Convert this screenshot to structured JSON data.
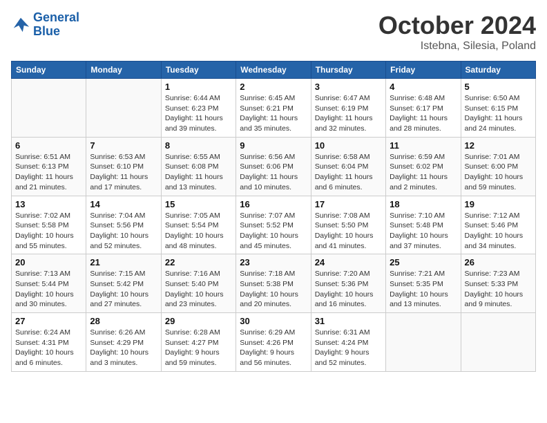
{
  "logo": {
    "line1": "General",
    "line2": "Blue"
  },
  "title": "October 2024",
  "location": "Istebna, Silesia, Poland",
  "headers": [
    "Sunday",
    "Monday",
    "Tuesday",
    "Wednesday",
    "Thursday",
    "Friday",
    "Saturday"
  ],
  "weeks": [
    [
      {
        "day": "",
        "info": ""
      },
      {
        "day": "",
        "info": ""
      },
      {
        "day": "1",
        "info": "Sunrise: 6:44 AM\nSunset: 6:23 PM\nDaylight: 11 hours and 39 minutes."
      },
      {
        "day": "2",
        "info": "Sunrise: 6:45 AM\nSunset: 6:21 PM\nDaylight: 11 hours and 35 minutes."
      },
      {
        "day": "3",
        "info": "Sunrise: 6:47 AM\nSunset: 6:19 PM\nDaylight: 11 hours and 32 minutes."
      },
      {
        "day": "4",
        "info": "Sunrise: 6:48 AM\nSunset: 6:17 PM\nDaylight: 11 hours and 28 minutes."
      },
      {
        "day": "5",
        "info": "Sunrise: 6:50 AM\nSunset: 6:15 PM\nDaylight: 11 hours and 24 minutes."
      }
    ],
    [
      {
        "day": "6",
        "info": "Sunrise: 6:51 AM\nSunset: 6:13 PM\nDaylight: 11 hours and 21 minutes."
      },
      {
        "day": "7",
        "info": "Sunrise: 6:53 AM\nSunset: 6:10 PM\nDaylight: 11 hours and 17 minutes."
      },
      {
        "day": "8",
        "info": "Sunrise: 6:55 AM\nSunset: 6:08 PM\nDaylight: 11 hours and 13 minutes."
      },
      {
        "day": "9",
        "info": "Sunrise: 6:56 AM\nSunset: 6:06 PM\nDaylight: 11 hours and 10 minutes."
      },
      {
        "day": "10",
        "info": "Sunrise: 6:58 AM\nSunset: 6:04 PM\nDaylight: 11 hours and 6 minutes."
      },
      {
        "day": "11",
        "info": "Sunrise: 6:59 AM\nSunset: 6:02 PM\nDaylight: 11 hours and 2 minutes."
      },
      {
        "day": "12",
        "info": "Sunrise: 7:01 AM\nSunset: 6:00 PM\nDaylight: 10 hours and 59 minutes."
      }
    ],
    [
      {
        "day": "13",
        "info": "Sunrise: 7:02 AM\nSunset: 5:58 PM\nDaylight: 10 hours and 55 minutes."
      },
      {
        "day": "14",
        "info": "Sunrise: 7:04 AM\nSunset: 5:56 PM\nDaylight: 10 hours and 52 minutes."
      },
      {
        "day": "15",
        "info": "Sunrise: 7:05 AM\nSunset: 5:54 PM\nDaylight: 10 hours and 48 minutes."
      },
      {
        "day": "16",
        "info": "Sunrise: 7:07 AM\nSunset: 5:52 PM\nDaylight: 10 hours and 45 minutes."
      },
      {
        "day": "17",
        "info": "Sunrise: 7:08 AM\nSunset: 5:50 PM\nDaylight: 10 hours and 41 minutes."
      },
      {
        "day": "18",
        "info": "Sunrise: 7:10 AM\nSunset: 5:48 PM\nDaylight: 10 hours and 37 minutes."
      },
      {
        "day": "19",
        "info": "Sunrise: 7:12 AM\nSunset: 5:46 PM\nDaylight: 10 hours and 34 minutes."
      }
    ],
    [
      {
        "day": "20",
        "info": "Sunrise: 7:13 AM\nSunset: 5:44 PM\nDaylight: 10 hours and 30 minutes."
      },
      {
        "day": "21",
        "info": "Sunrise: 7:15 AM\nSunset: 5:42 PM\nDaylight: 10 hours and 27 minutes."
      },
      {
        "day": "22",
        "info": "Sunrise: 7:16 AM\nSunset: 5:40 PM\nDaylight: 10 hours and 23 minutes."
      },
      {
        "day": "23",
        "info": "Sunrise: 7:18 AM\nSunset: 5:38 PM\nDaylight: 10 hours and 20 minutes."
      },
      {
        "day": "24",
        "info": "Sunrise: 7:20 AM\nSunset: 5:36 PM\nDaylight: 10 hours and 16 minutes."
      },
      {
        "day": "25",
        "info": "Sunrise: 7:21 AM\nSunset: 5:35 PM\nDaylight: 10 hours and 13 minutes."
      },
      {
        "day": "26",
        "info": "Sunrise: 7:23 AM\nSunset: 5:33 PM\nDaylight: 10 hours and 9 minutes."
      }
    ],
    [
      {
        "day": "27",
        "info": "Sunrise: 6:24 AM\nSunset: 4:31 PM\nDaylight: 10 hours and 6 minutes."
      },
      {
        "day": "28",
        "info": "Sunrise: 6:26 AM\nSunset: 4:29 PM\nDaylight: 10 hours and 3 minutes."
      },
      {
        "day": "29",
        "info": "Sunrise: 6:28 AM\nSunset: 4:27 PM\nDaylight: 9 hours and 59 minutes."
      },
      {
        "day": "30",
        "info": "Sunrise: 6:29 AM\nSunset: 4:26 PM\nDaylight: 9 hours and 56 minutes."
      },
      {
        "day": "31",
        "info": "Sunrise: 6:31 AM\nSunset: 4:24 PM\nDaylight: 9 hours and 52 minutes."
      },
      {
        "day": "",
        "info": ""
      },
      {
        "day": "",
        "info": ""
      }
    ]
  ]
}
